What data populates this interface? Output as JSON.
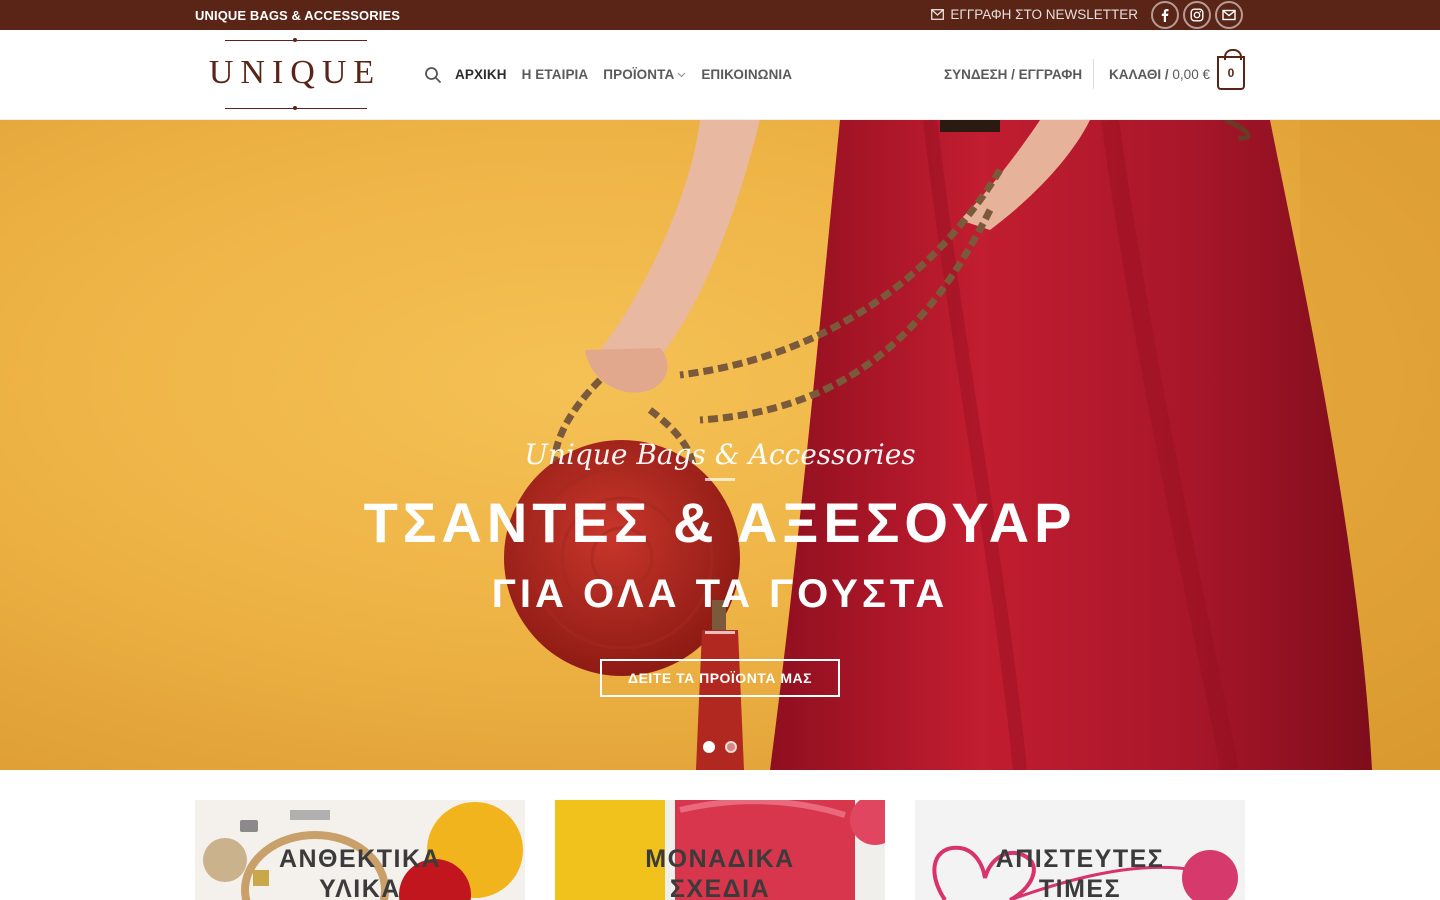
{
  "topbar": {
    "brand_text": "UNIQUE BAGS & ACCESSORIES",
    "newsletter_label": "ΕΓΓΡΑΦΗ ΣΤΟ NEWSLETTER"
  },
  "header": {
    "logo_text": "UNIQUE",
    "nav": [
      {
        "label": "ΑΡΧΙΚΗ"
      },
      {
        "label": "Η ΕΤΑΙΡΙΑ"
      },
      {
        "label": "ΠΡΟΪΟΝΤΑ"
      },
      {
        "label": "ΕΠΙΚΟΙΝΩΝΙΑ"
      }
    ],
    "account_label": "ΣΥΝΔΕΣΗ / ΕΓΓΡΑΦΗ",
    "cart_label": "ΚΑΛΑΘΙ /",
    "cart_total": "0,00 €",
    "cart_count": "0"
  },
  "hero": {
    "script_subtitle": "Unique Bags & Accessories",
    "title": "ΤΣΑΝΤΕΣ & ΑΞΕΣΟΥΑΡ",
    "subtitle": "ΓΙΑ ΟΛΑ ΤΑ ΓΟΥΣΤΑ",
    "cta_label": "ΔΕΙΤΕ ΤΑ ΠΡΟΪΟΝΤΑ ΜΑΣ",
    "active_slide": 1,
    "slide_count": 2
  },
  "features": [
    {
      "line1": "ΑΝΘΕΚΤΙΚΑ",
      "line2": "ΥΛΙΚΑ"
    },
    {
      "line1": "ΜΟΝΑΔΙΚΑ",
      "line2": "ΣΧΕΔΙΑ"
    },
    {
      "line1": "ΑΠΙΣΤΕΥΤΕΣ",
      "line2": "ΤΙΜΕΣ"
    }
  ],
  "colors": {
    "brand": "#5a2516",
    "hero_bg": "#eeb345",
    "dress": "#b5192b"
  },
  "icons": [
    "envelope-icon",
    "facebook-icon",
    "instagram-icon",
    "email-icon",
    "search-icon",
    "chevron-down-icon",
    "cart-icon"
  ]
}
